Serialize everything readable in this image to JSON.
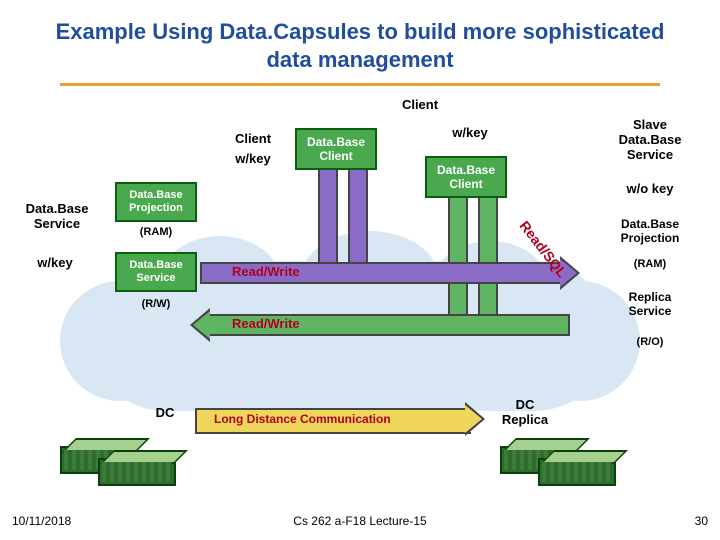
{
  "title": "Example Using Data.Capsules to build more sophisticated data management",
  "labels": {
    "client_top": "Client",
    "client_left": "Client",
    "wkey_left": "w/key",
    "db_client_mid": "Data.Base\nClient",
    "wkey_top_right": "w/key",
    "slave_service": "Slave\nData.Base\nService",
    "db_client_right": "Data.Base\nClient",
    "wo_key": "w/o key",
    "db_projection_left": "Data.Base\nProjection",
    "db_service_left": "Data.Base\nService",
    "ram": "(RAM)",
    "wkey_far_left": "w/key",
    "db_service_box": "Data.Base\nService",
    "rw_mode": "(R/W)",
    "db_projection_right": "Data.Base\nProjection",
    "ram_right": "(RAM)",
    "replica_service": "Replica\nService",
    "ro_mode": "(R/O)",
    "dc": "DC",
    "dc_replica": "DC\nReplica"
  },
  "arrows": {
    "rw1": "Read/Write",
    "rw2": "Read/Write",
    "diag": "Read/SQL",
    "ldc": "Long Distance Communication"
  },
  "footer": {
    "date": "10/11/2018",
    "center": "Cs 262 a-F18 Lecture-15",
    "page": "30"
  }
}
